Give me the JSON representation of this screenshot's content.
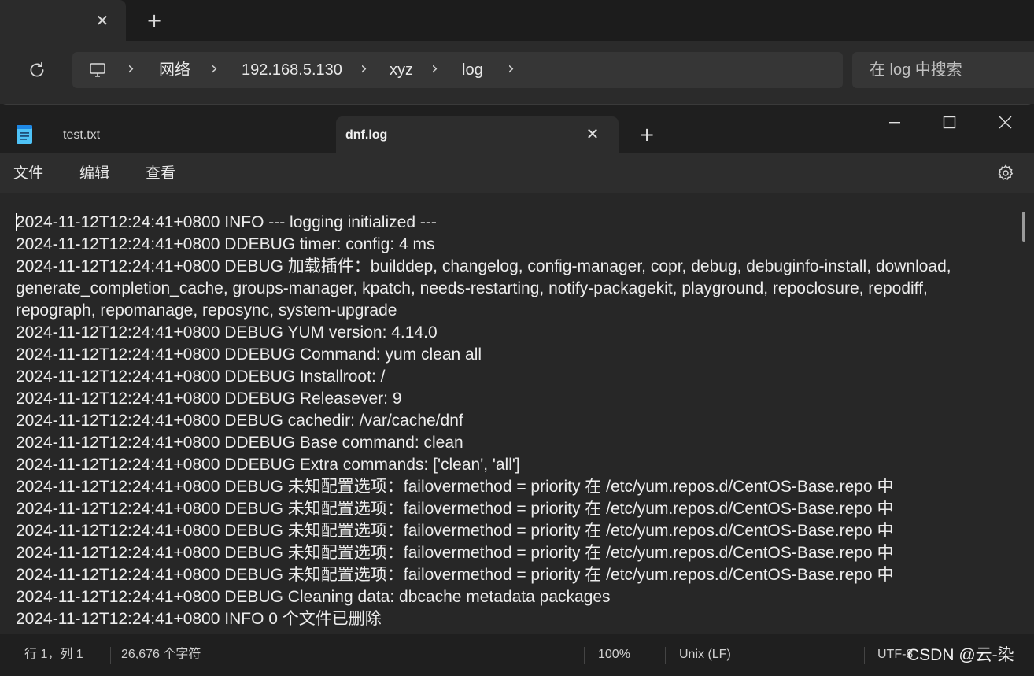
{
  "explorer": {
    "new_tab_symbol": "+",
    "close_symbol": "✕",
    "breadcrumbs": [
      "网络",
      "192.168.5.130",
      "xyz",
      "log"
    ],
    "search_placeholder": "在 log 中搜索"
  },
  "notepad": {
    "tabs": [
      {
        "label": "test.txt",
        "active": false
      },
      {
        "label": "dnf.log",
        "active": true
      }
    ],
    "new_tab_symbol": "+",
    "menu": [
      "文件",
      "编辑",
      "查看"
    ],
    "content_lines": [
      "2024-11-12T12:24:41+0800 INFO --- logging initialized ---",
      "2024-11-12T12:24:41+0800 DDEBUG timer: config: 4 ms",
      "2024-11-12T12:24:41+0800 DEBUG 加载插件：builddep, changelog, config-manager, copr, debug, debuginfo-install, download, generate_completion_cache, groups-manager, kpatch, needs-restarting, notify-packagekit, playground, repoclosure, repodiff, repograph, repomanage, reposync, system-upgrade",
      "2024-11-12T12:24:41+0800 DEBUG YUM version: 4.14.0",
      "2024-11-12T12:24:41+0800 DDEBUG Command: yum clean all",
      "2024-11-12T12:24:41+0800 DDEBUG Installroot: /",
      "2024-11-12T12:24:41+0800 DDEBUG Releasever: 9",
      "2024-11-12T12:24:41+0800 DEBUG cachedir: /var/cache/dnf",
      "2024-11-12T12:24:41+0800 DDEBUG Base command: clean",
      "2024-11-12T12:24:41+0800 DDEBUG Extra commands: ['clean', 'all']",
      "2024-11-12T12:24:41+0800 DEBUG 未知配置选项：failovermethod = priority 在 /etc/yum.repos.d/CentOS-Base.repo 中",
      "2024-11-12T12:24:41+0800 DEBUG 未知配置选项：failovermethod = priority 在 /etc/yum.repos.d/CentOS-Base.repo 中",
      "2024-11-12T12:24:41+0800 DEBUG 未知配置选项：failovermethod = priority 在 /etc/yum.repos.d/CentOS-Base.repo 中",
      "2024-11-12T12:24:41+0800 DEBUG 未知配置选项：failovermethod = priority 在 /etc/yum.repos.d/CentOS-Base.repo 中",
      "2024-11-12T12:24:41+0800 DEBUG 未知配置选项：failovermethod = priority 在 /etc/yum.repos.d/CentOS-Base.repo 中",
      "2024-11-12T12:24:41+0800 DEBUG Cleaning data: dbcache metadata packages",
      "2024-11-12T12:24:41+0800 INFO 0 个文件已删除"
    ],
    "status": {
      "position": "行 1，列 1",
      "char_count": "26,676 个字符",
      "zoom": "100%",
      "line_ending": "Unix (LF)",
      "encoding": "UTF-8"
    }
  },
  "watermark": "CSDN @云-染"
}
